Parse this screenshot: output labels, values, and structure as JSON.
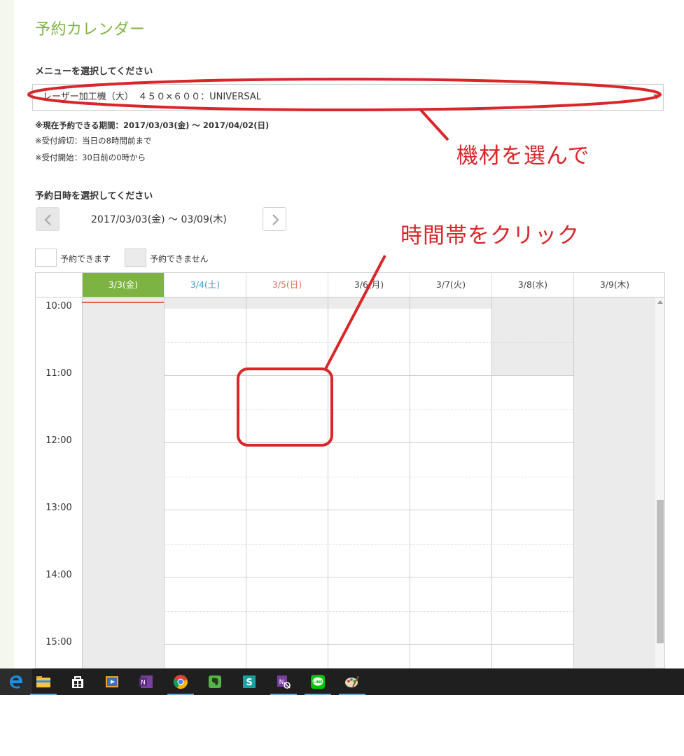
{
  "page": {
    "title": "予約カレンダー",
    "menu_label": "メニューを選択してください",
    "selected_menu": "レーザー加工機（大）　４５０×６００：UNIVERSAL",
    "period_notice": "※現在予約できる期間：2017/03/03(金) ～ 2017/04/02(日)",
    "deadline_notice": "※受付締切：当日の8時間前まで",
    "start_notice": "※受付開始：30日前の0時から",
    "datetime_label": "予約日時を選択してください",
    "week_range": "2017/03/03(金) ～ 03/09(木)",
    "legend_available": "予約できます",
    "legend_unavailable": "予約できません"
  },
  "calendar": {
    "days": [
      {
        "label": "3/3(金)",
        "kind": "today"
      },
      {
        "label": "3/4(土)",
        "kind": "sat"
      },
      {
        "label": "3/5(日)",
        "kind": "sun"
      },
      {
        "label": "3/6(月)",
        "kind": "weekday"
      },
      {
        "label": "3/7(火)",
        "kind": "weekday"
      },
      {
        "label": "3/8(水)",
        "kind": "weekday"
      },
      {
        "label": "3/9(木)",
        "kind": "weekday"
      }
    ],
    "times": [
      "10:00",
      "11:00",
      "12:00",
      "13:00",
      "14:00",
      "15:00"
    ]
  },
  "annotations": {
    "choose_equipment": "機材を選んで",
    "click_timeslot": "時間帯をクリック"
  },
  "taskbar": {
    "icons": [
      "edge-icon",
      "file-explorer-icon",
      "store-icon",
      "media-player-icon",
      "onenote-icon",
      "chrome-icon",
      "evernote-icon",
      "sway-icon",
      "onenote-clipper-icon",
      "line-icon",
      "paint-icon"
    ]
  },
  "colors": {
    "accent_green": "#7cb342",
    "saturday_blue": "#3b9bd1",
    "sunday_red": "#e0705c",
    "annotation_red": "#d9262a"
  }
}
